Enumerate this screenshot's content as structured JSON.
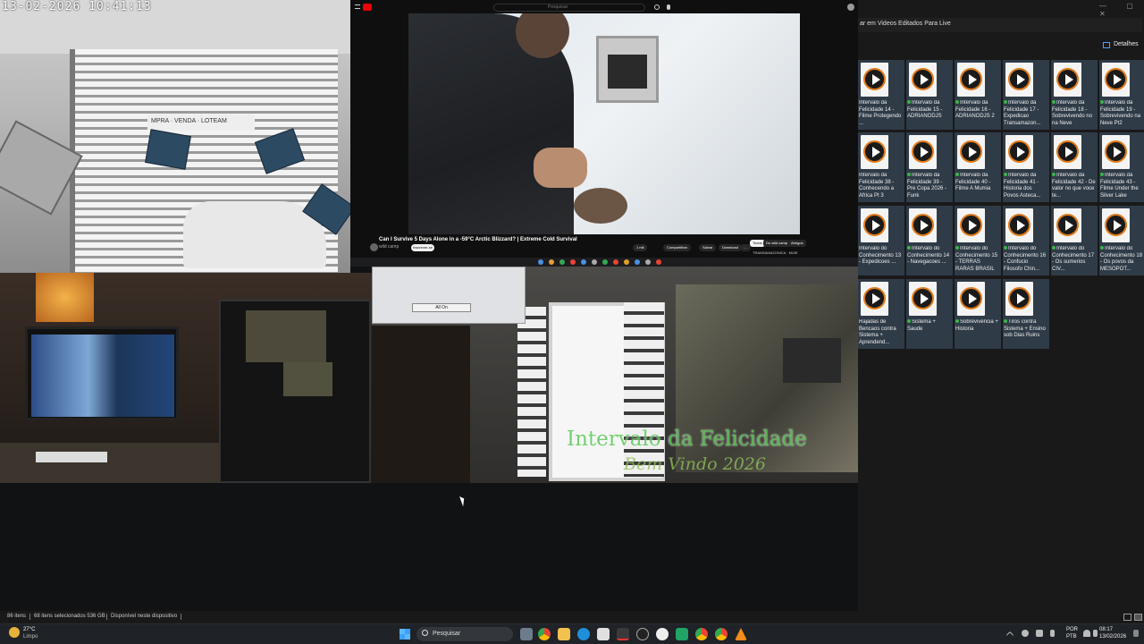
{
  "camera1": {
    "timestamp": "13-02-2026  10:41:13",
    "sign_text": "MPRA · VENDA · LOTEAM"
  },
  "youtube": {
    "search_placeholder": "Pesquisar",
    "video_title": "Can I Survive 5 Days Alone in a -59°C Arctic Blizzard? | Extreme Cold Survival",
    "channel": "wild camp",
    "subscribe_label": "Inscrever-se",
    "actions": [
      "1 mil",
      "Compartilhar",
      "Salvar",
      "Download",
      "…"
    ],
    "chips": [
      "Todos",
      "Do wild camp",
      "Abrigos"
    ],
    "sidebar_header": "TRANSAMAZONICA · MUIE"
  },
  "overlay_panel": {
    "button_label": "All On"
  },
  "overlay": {
    "title": "Intervalo da Felicidade",
    "subtitle": "Bem Vindo 2026"
  },
  "explorer": {
    "search_text": "ar em Videos Editados Para Live",
    "details_label": "Detalhes",
    "files": [
      {
        "name": "Intervalo da Felicidade 14 - Filme Protegendo ...",
        "synced": false
      },
      {
        "name": "Intervalo da Felicidade 15 - ADRIANODJS",
        "synced": true
      },
      {
        "name": "Intervalo da Felicidade 16 - ADRIANODJS 2",
        "synced": true
      },
      {
        "name": "Intervalo da Felicidade 17 - Expedicao Transamazon...",
        "synced": true
      },
      {
        "name": "Intervalo da Felicidade 18 - Sobrevivendo no na Neve",
        "synced": true
      },
      {
        "name": "Intervalo da Felicidade 19 - Sobrevivendo na Neve Pt2",
        "synced": true
      },
      {
        "name": "Intervalo da Felicidade 38 - Conhecendo a Africa Pt 3",
        "synced": false
      },
      {
        "name": "Intervalo da Felicidade 39 - Pre Copa 2026 - Funk",
        "synced": true
      },
      {
        "name": "Intervalo da Felicidade 40 - Filme A Mumia",
        "synced": true
      },
      {
        "name": "Intervalo da Felicidade 41 - Historia dos Povos Asteca...",
        "synced": true
      },
      {
        "name": "Intervalo da Felicidade 42 - De valor no que voce te...",
        "synced": true
      },
      {
        "name": "Intervalo da Felicidade 43 - Filme Under the Silver Lake",
        "synced": true
      },
      {
        "name": "Intervalo do Conhecimento 13 - Expedicoes ...",
        "synced": false
      },
      {
        "name": "Intervalo do Conhecimento 14 - Navegacoes ...",
        "synced": true
      },
      {
        "name": "Intervalo do Conhecimento 15 - TERRAS RARAS BRASIL",
        "synced": true
      },
      {
        "name": "Intervalo do Conhecimento 16 - Confucio Filosofo Chin...",
        "synced": true
      },
      {
        "name": "Intervalo do Conhecimento 17 - Os sumerios CIV...",
        "synced": true
      },
      {
        "name": "Intervalo do Conhecimento 18 - Os povos da MESOPOT...",
        "synced": true
      },
      {
        "name": "Rajadas de Bencaos contra Sistema + Aprendend...",
        "synced": false
      },
      {
        "name": "Sistema + Saude",
        "synced": true
      },
      {
        "name": "Sobrevivencia + Historia",
        "synced": true
      },
      {
        "name": "Tiros contra Sistema + Ensino sob Dias Ruins",
        "synced": true
      }
    ]
  },
  "statusbar": {
    "items_count": "86 itens",
    "selected": "68 itens selecionados  536 GB",
    "availability": "Disponível neste dispositivo"
  },
  "taskbar": {
    "weather_temp": "27°C",
    "weather_desc": "Limpo",
    "search_label": "Pesquisar",
    "lang1": "POR",
    "lang2": "PTB",
    "time": "08:17",
    "date": "13/02/2026"
  },
  "accent_colors": {
    "selection": "#2f3b47",
    "sync_green": "#3bb34a",
    "yt_red": "#e00000"
  }
}
